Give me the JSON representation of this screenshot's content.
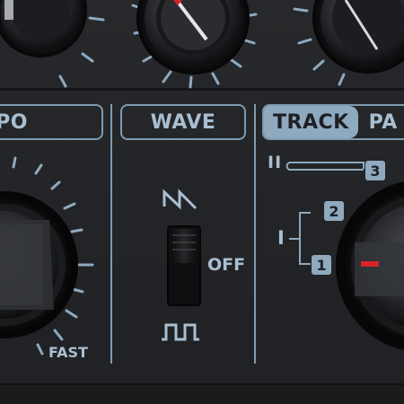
{
  "sections": {
    "tempo": {
      "label": "PO"
    },
    "wave": {
      "label": "WAVE",
      "switch_off_label": "OFF"
    },
    "track": {
      "label_active": "TRACK",
      "label_other": "PA"
    }
  },
  "tempo_scale": {
    "fast_label": "FAST"
  },
  "track_diagram": {
    "route_ii": "II",
    "route_i": "I",
    "badge_3": "3",
    "badge_2": "2",
    "badge_1": "1"
  },
  "colors": {
    "accent": "#8fa9bf",
    "indicator": "#d6242b",
    "panel": "#232528"
  }
}
